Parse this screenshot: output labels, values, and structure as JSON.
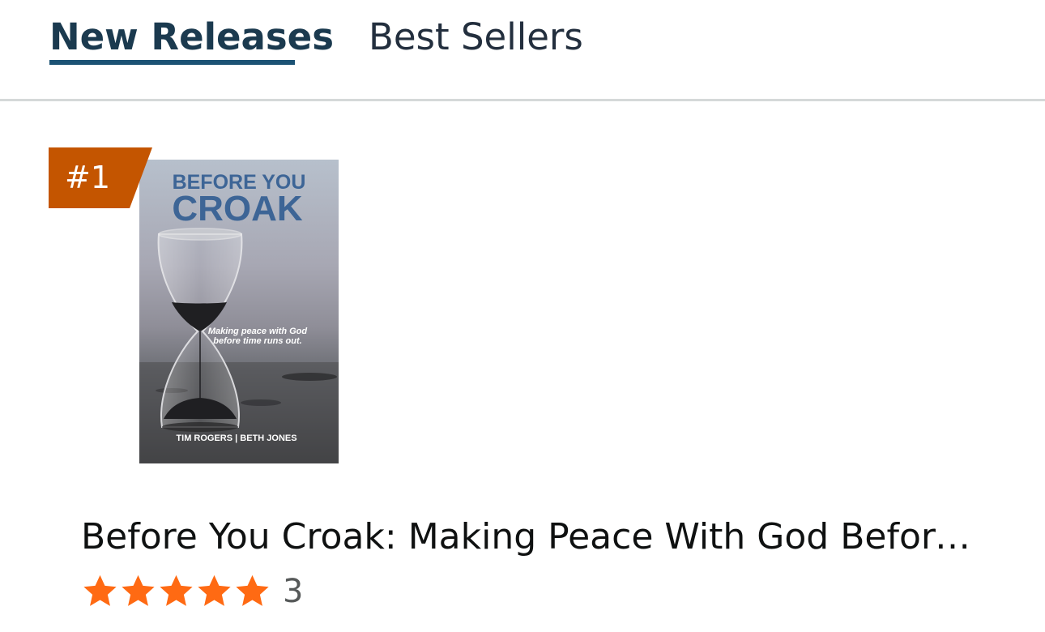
{
  "tabs": [
    {
      "label": "New Releases",
      "active": true
    },
    {
      "label": "Best Sellers",
      "active": false
    }
  ],
  "product": {
    "rank": "#1",
    "cover": {
      "title_line1": "BEFORE YOU",
      "title_line2": "CROAK",
      "tagline_line1": "Making peace with God",
      "tagline_line2": "before time runs out.",
      "authors": "TIM ROGERS | BETH JONES"
    },
    "title": "Before You Croak: Making Peace With God Before Time Runs Out",
    "rating": {
      "stars": 5,
      "count": "3"
    }
  },
  "colors": {
    "badge": "#c45500",
    "star": "#ff6a13",
    "tab_underline": "#1b5274"
  }
}
